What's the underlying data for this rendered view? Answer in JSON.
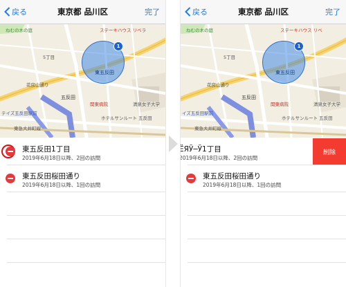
{
  "left": {
    "nav": {
      "back_label": "戻る",
      "title": "東京都 品川区",
      "done_label": "完了"
    },
    "rows": [
      {
        "title": "東五反田1丁目",
        "subtitle": "2019年6月18日以降、2回の訪問"
      },
      {
        "title": "東五反田桜田通り",
        "subtitle": "2019年6月18日以降、1回の訪問"
      }
    ]
  },
  "right": {
    "nav": {
      "back_label": "戻る",
      "title": "東京都 品川区",
      "done_label": "完了"
    },
    "rows": [
      {
        "title": "ЁЯЎ─Ў1丁目",
        "subtitle": "2019年6月18日以降、2回の訪問",
        "delete_label": "削除"
      },
      {
        "title": "東五反田桜田通り",
        "subtitle": "2019年6月18日以降、1回の訪問"
      }
    ]
  },
  "map": {
    "labels": {
      "park": "ねむの木の庭",
      "steak": "ステーキハウス リベラ",
      "block5": "5丁目",
      "area": "東五反田",
      "street": "花房山通り",
      "station": "五反田",
      "hospital": "関東病院",
      "university": "清泉女子大学",
      "ekimae": "テイズ五反田駅前",
      "hotel": "ホテルサンルート 五反田",
      "tokyu": "東急大井町線",
      "bottom": "ホテルサンルート 五反田",
      "marker_number": "1"
    },
    "right_labels": {
      "ekimae": "イズ五反田駅前",
      "steak": "ステーキハウス リベ",
      "park": "ねむの木の庭"
    }
  },
  "colors": {
    "accent": "#1c7cf4",
    "delete": "#f33b30",
    "highlight": "#d80f16"
  }
}
